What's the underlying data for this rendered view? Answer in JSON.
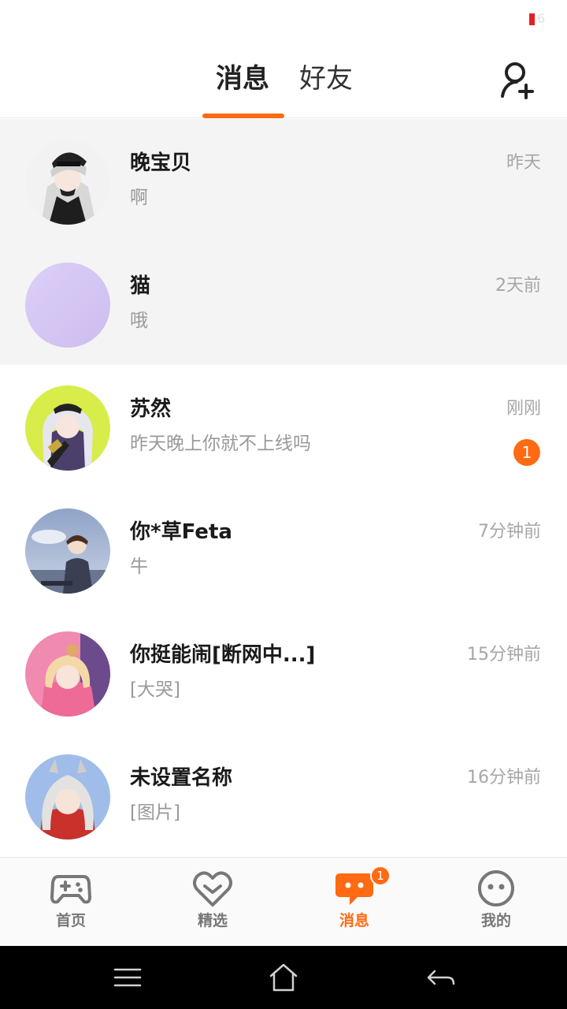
{
  "statusbar": {
    "battery_text": "6"
  },
  "header": {
    "tabs": [
      {
        "label": "消息",
        "active": true
      },
      {
        "label": "好友",
        "active": false
      }
    ],
    "accent_color": "#ff6a13"
  },
  "conversations": [
    {
      "name": "晚宝贝",
      "preview": "啊",
      "time": "昨天",
      "pinned": true
    },
    {
      "name": "猫",
      "preview": "哦",
      "time": "2天前",
      "pinned": true
    },
    {
      "name": "苏然",
      "preview": "昨天晚上你就不上线吗",
      "time": "刚刚",
      "unread": "1"
    },
    {
      "name": "你*草Feta",
      "preview": "牛",
      "time": "7分钟前"
    },
    {
      "name": "你挺能闹[断网中...]",
      "preview": "[大哭]",
      "time": "15分钟前"
    },
    {
      "name": "未设置名称",
      "preview": "[图片]",
      "time": "16分钟前"
    }
  ],
  "bottom_nav": [
    {
      "label": "首页",
      "icon": "gamepad-icon",
      "active": false
    },
    {
      "label": "精选",
      "icon": "heart-chevron-icon",
      "active": false
    },
    {
      "label": "消息",
      "icon": "chat-bubble-icon",
      "active": true,
      "badge": "1"
    },
    {
      "label": "我的",
      "icon": "face-icon",
      "active": false
    }
  ],
  "system_nav": [
    "menu-icon",
    "home-icon",
    "back-icon"
  ]
}
